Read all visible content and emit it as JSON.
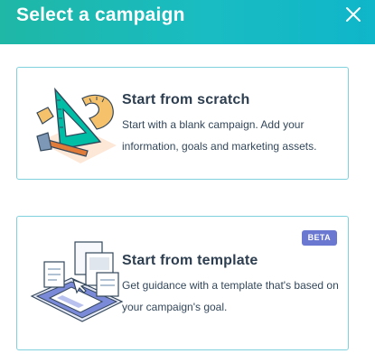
{
  "header": {
    "title": "Select a campaign",
    "close_icon": "close-icon"
  },
  "cards": [
    {
      "title": "Start from scratch",
      "description": "Start with a blank campaign. Add your information, goals and marketing assets.",
      "illustration": "tools-illustration"
    },
    {
      "title": "Start from template",
      "description": "Get guidance with a template that's based on your campaign's goal.",
      "badge": "BETA",
      "illustration": "template-illustration"
    }
  ],
  "colors": {
    "header_start": "#1fb7a6",
    "header_end": "#0fb6c9",
    "card_border": "#7fd1de",
    "badge": "#6a78d1",
    "title_text": "#2d3e50"
  }
}
